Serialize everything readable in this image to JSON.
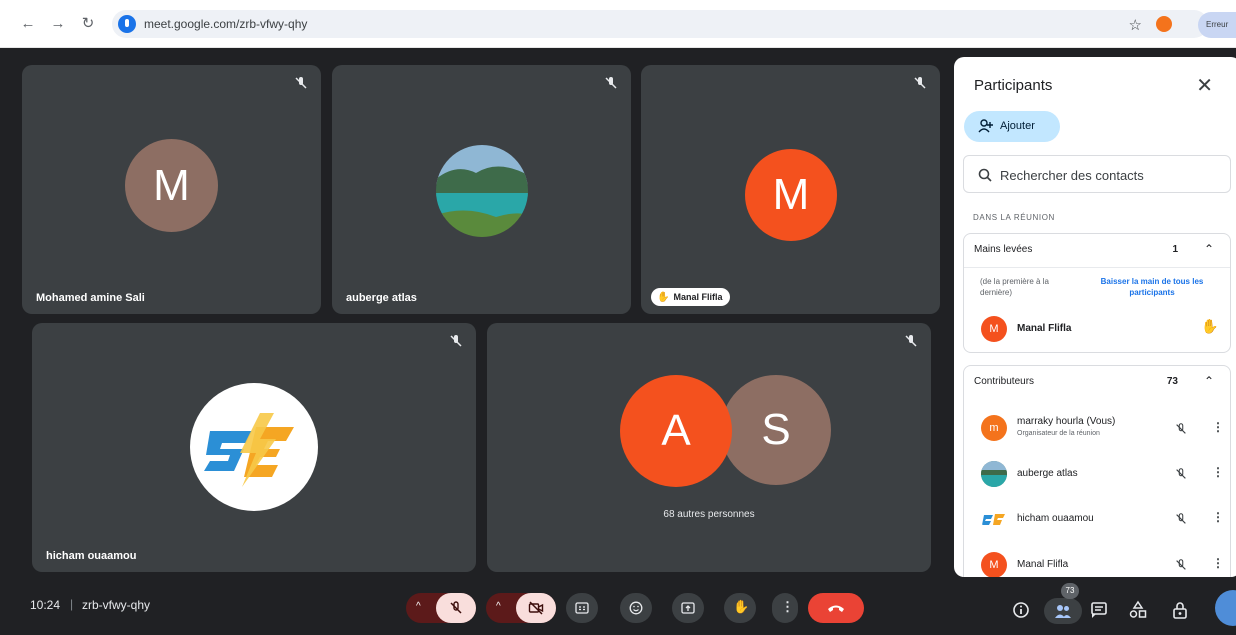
{
  "browser": {
    "url": "meet.google.com/zrb-vfwy-qhy",
    "profile_label": "Erreur"
  },
  "tiles": [
    {
      "name": "Mohamed amine Sali",
      "avatar_letter": "M",
      "avatar_color": "#8d6e63"
    },
    {
      "name": "auberge atlas",
      "avatar_letter": "",
      "avatar_color": "#4a7f6a"
    },
    {
      "name": "Manal Flifla",
      "avatar_letter": "M",
      "avatar_color": "#f4511e"
    },
    {
      "name": "hicham ouaamou",
      "avatar_letter": "",
      "avatar_color": "#ffffff"
    },
    {
      "name": "68 autres personnes",
      "avatar_letters": [
        "A",
        "S"
      ],
      "avatar_colors": [
        "#f4511e",
        "#8d6e63"
      ]
    }
  ],
  "panel": {
    "title": "Participants",
    "add_label": "Ajouter",
    "search_placeholder": "Rechercher des contacts",
    "section_label": "DANS LA RÉUNION",
    "raised_hands": {
      "title": "Mains levées",
      "count": "1",
      "order_note": "(de la première à la dernière)",
      "lower_all": "Baisser la main de tous les participants",
      "people": [
        {
          "name": "Manal Flifla",
          "letter": "M",
          "color": "#f4511e"
        }
      ]
    },
    "contributors": {
      "title": "Contributeurs",
      "count": "73",
      "people": [
        {
          "name": "marraky hourla (Vous)",
          "sub": "Organisateur de la réunion",
          "letter": "m",
          "color": "#f4731c"
        },
        {
          "name": "auberge atlas",
          "sub": "",
          "letter": "",
          "color": "#4a7f6a"
        },
        {
          "name": "hicham ouaamou",
          "sub": "",
          "letter": "",
          "color": "#ffffff"
        },
        {
          "name": "Manal Flifla",
          "sub": "",
          "letter": "M",
          "color": "#f4511e"
        }
      ]
    }
  },
  "bottombar": {
    "time": "10:24",
    "separator": "|",
    "meeting_code": "zrb-vfwy-qhy",
    "participants_badge": "73"
  },
  "icons": {
    "mic_off": "mic-off-icon",
    "cam_off": "videocam-off-icon",
    "captions": "captions-icon",
    "emoji": "emoji-icon",
    "present": "present-screen-icon",
    "hand": "raise-hand-icon",
    "more": "more-vert-icon",
    "end_call": "call-end-icon",
    "info": "info-icon",
    "people": "people-icon",
    "chat": "chat-icon",
    "activities": "activities-icon",
    "lock": "host-controls-icon"
  }
}
